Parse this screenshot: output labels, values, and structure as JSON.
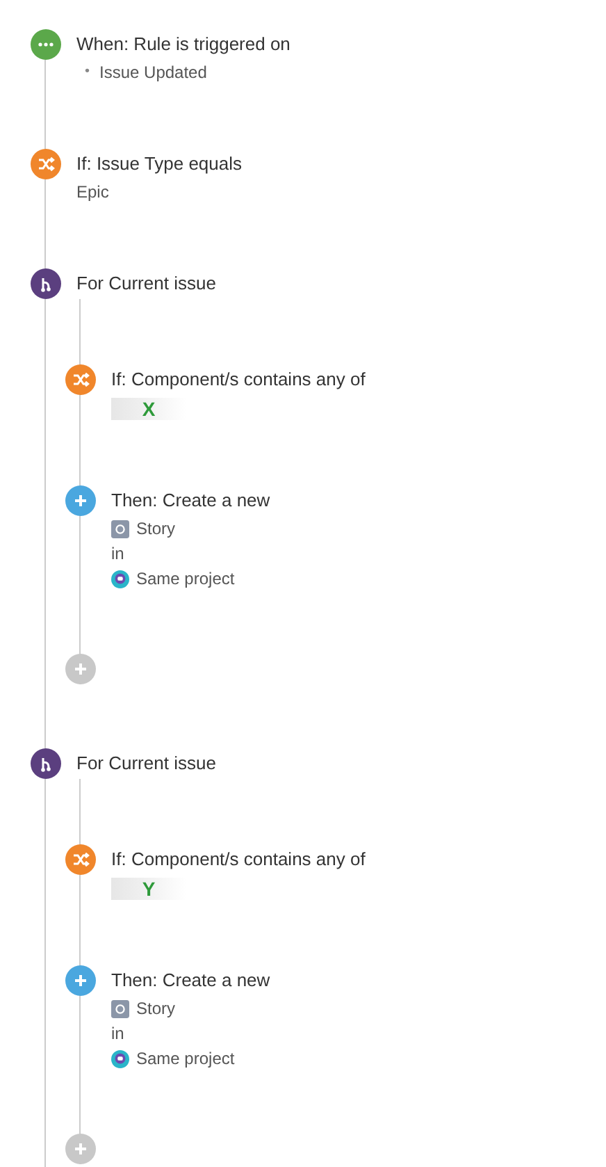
{
  "flow": [
    {
      "kind": "trigger",
      "title": "When: Rule is triggered on",
      "items": [
        {
          "bullet": "•",
          "text": "Issue Updated"
        }
      ]
    },
    {
      "kind": "condition",
      "title": "If: Issue Type equals",
      "value": "Epic"
    },
    {
      "kind": "branch",
      "title": "For Current issue",
      "children": [
        {
          "kind": "condition",
          "title": "If: Component/s contains any of",
          "tag": "X"
        },
        {
          "kind": "action",
          "title": "Then: Create a new",
          "issue_type": "Story",
          "joiner": "in",
          "project": "Same project"
        },
        {
          "kind": "add"
        }
      ]
    },
    {
      "kind": "branch",
      "title": "For Current issue",
      "children": [
        {
          "kind": "condition",
          "title": "If: Component/s contains any of",
          "tag": "Y"
        },
        {
          "kind": "action",
          "title": "Then: Create a new",
          "issue_type": "Story",
          "joiner": "in",
          "project": "Same project"
        },
        {
          "kind": "add"
        }
      ]
    }
  ]
}
